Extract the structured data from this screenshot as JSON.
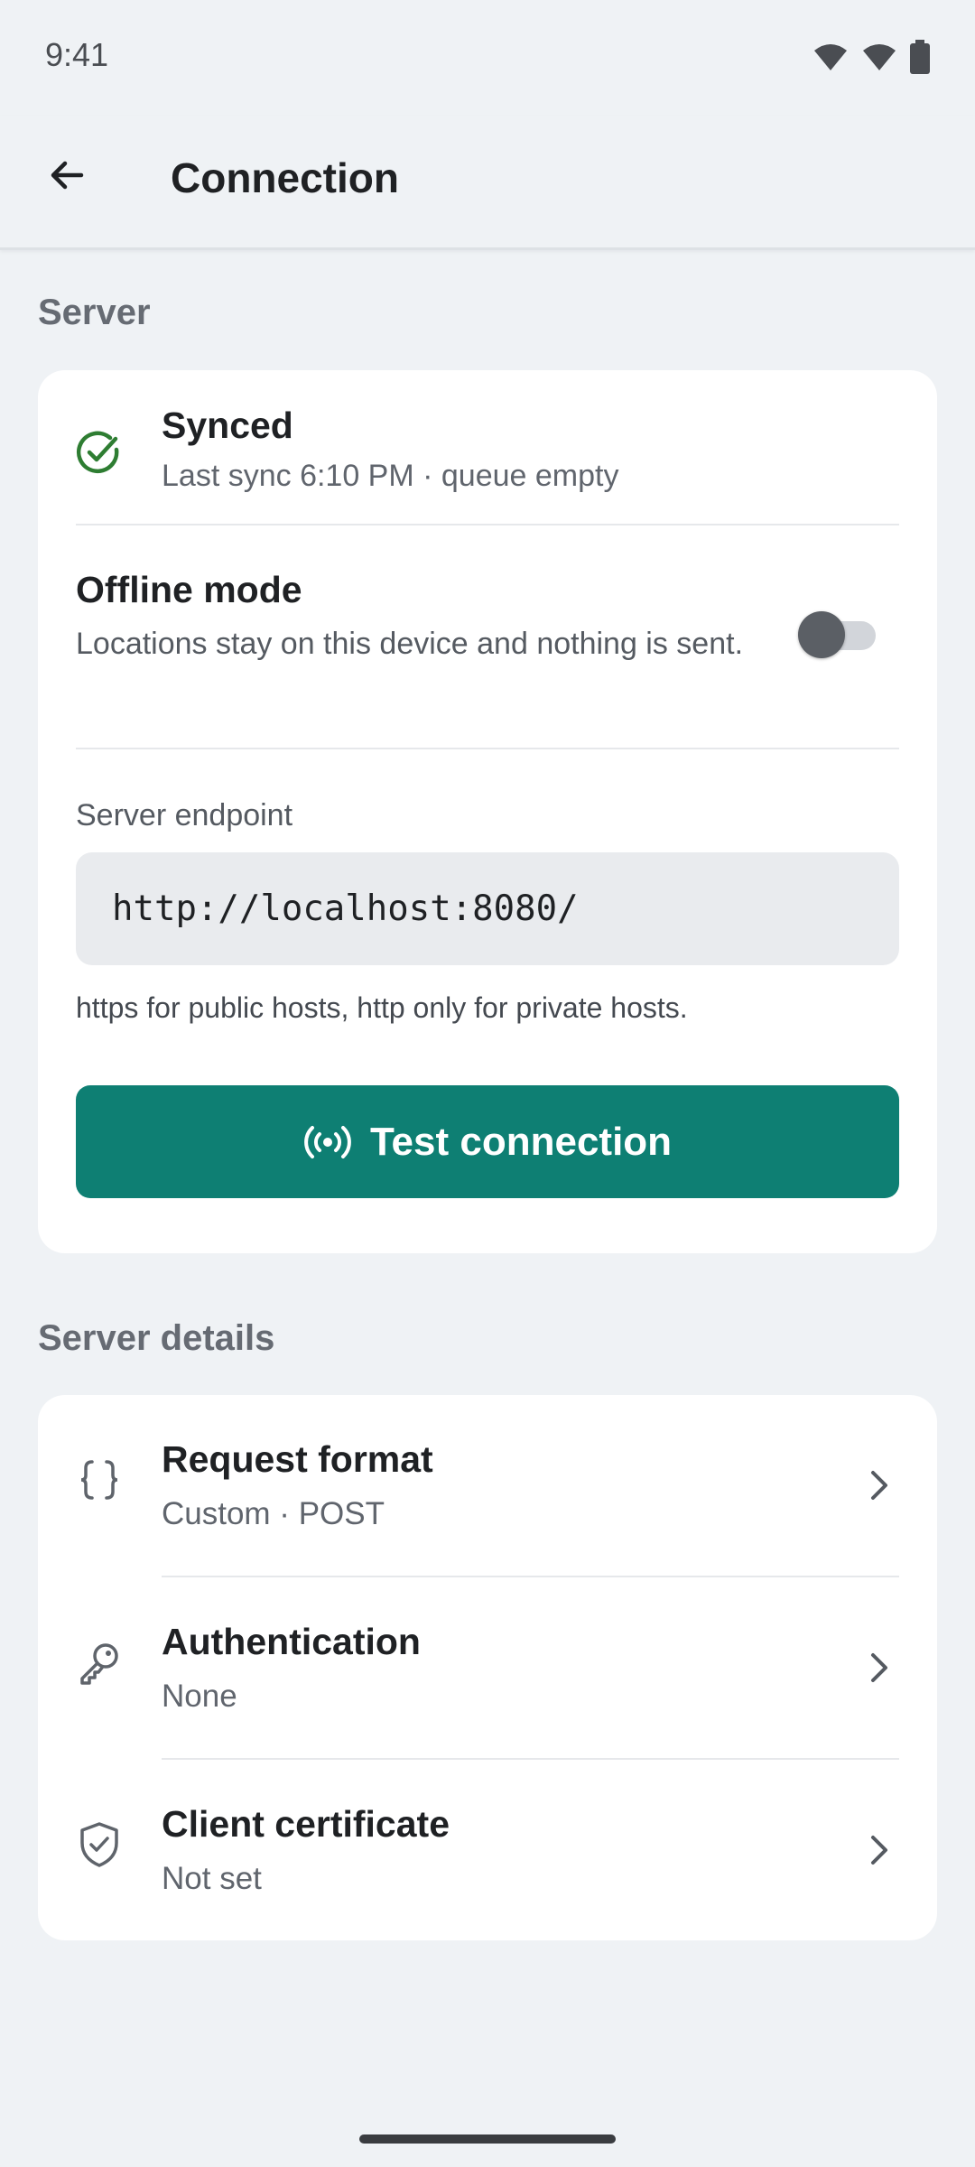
{
  "status": {
    "time": "9:41"
  },
  "app_bar": {
    "title": "Connection"
  },
  "server": {
    "section_label": "Server",
    "sync": {
      "title": "Synced",
      "subtitle": "Last sync 6:10 PM · queue empty"
    },
    "offline": {
      "title": "Offline mode",
      "description": "Locations stay on this device and nothing is sent.",
      "enabled": false
    },
    "endpoint": {
      "label": "Server endpoint",
      "value": "http://localhost:8080/",
      "hint": "https for public hosts, http only for private hosts."
    },
    "test_button": {
      "label": "Test connection"
    }
  },
  "details": {
    "section_label": "Server details",
    "items": [
      {
        "title": "Request format",
        "subtitle": "Custom · POST",
        "icon": "braces-icon"
      },
      {
        "title": "Authentication",
        "subtitle": "None",
        "icon": "key-icon"
      },
      {
        "title": "Client certificate",
        "subtitle": "Not set",
        "icon": "shield-check-icon"
      }
    ]
  },
  "colors": {
    "accent": "#0e7f73",
    "success": "#2e7d32",
    "background": "#eff2f5"
  }
}
